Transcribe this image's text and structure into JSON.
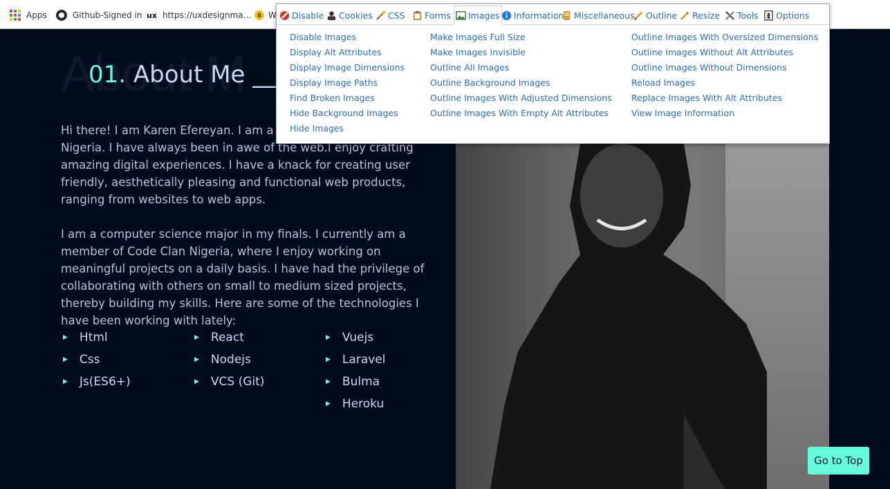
{
  "bookmarks": {
    "items": [
      {
        "label": "Apps"
      },
      {
        "label": "Github-Signed in"
      },
      {
        "label": "https://uxdesignma..."
      },
      {
        "label": "W"
      }
    ]
  },
  "about": {
    "ghost_text": "About M",
    "title_number": "01.",
    "title_text": "About Me __",
    "paragraphs": [
      "Hi there! I am Karen Efereyan. I am a fro",
      "Nigeria. I have always been in awe of the web.I enjoy crafting amazing digital experiences. I have a knack for creating user friendly, aesthetically pleasing and functional web products, ranging from websites to web apps.",
      "I am a computer science major in my finals. I currently am a member of Code Clan Nigeria, where I enjoy working on meaningful projects on a daily basis. I have had the privilege of collaborating with others on small to medium sized projects, thereby building my skills. Here are some of the technologies I have been working with lately:"
    ],
    "technologies": [
      "Html",
      "Css",
      "Js(ES6+)",
      "React",
      "Nodejs",
      "VCS (Git)",
      "Vuejs",
      "Laravel",
      "Bulma",
      "Heroku"
    ]
  },
  "go_top": {
    "label": "Go to Top"
  },
  "webdev_toolbar": {
    "tabs": [
      {
        "label": "Disable",
        "icon": "disable-icon"
      },
      {
        "label": "Cookies",
        "icon": "cookies-icon"
      },
      {
        "label": "CSS",
        "icon": "css-icon"
      },
      {
        "label": "Forms",
        "icon": "forms-icon"
      },
      {
        "label": "Images",
        "icon": "images-icon",
        "active": true
      },
      {
        "label": "Information",
        "icon": "information-icon"
      },
      {
        "label": "Miscellaneous",
        "icon": "miscellaneous-icon"
      },
      {
        "label": "Outline",
        "icon": "outline-icon"
      },
      {
        "label": "Resize",
        "icon": "resize-icon"
      },
      {
        "label": "Tools",
        "icon": "tools-icon"
      },
      {
        "label": "Options",
        "icon": "options-icon"
      }
    ],
    "menu_columns": [
      [
        "Disable Images",
        "Display Alt Attributes",
        "Display Image Dimensions",
        "Display Image Paths",
        "Find Broken Images",
        "Hide Background Images",
        "Hide Images"
      ],
      [
        "Make Images Full Size",
        "Make Images Invisible",
        "Outline All Images",
        "Outline Background Images",
        "Outline Images With Adjusted Dimensions",
        "Outline Images With Empty Alt Attributes"
      ],
      [
        "Outline Images With Oversized Dimensions",
        "Outline Images Without Alt Attributes",
        "Outline Images Without Dimensions",
        "Reload Images",
        "Replace Images With Alt Attributes",
        "View Image Information"
      ]
    ],
    "colors": {
      "link": "#2a6ebb",
      "accent": "#64ffda",
      "page_bg": "#020c1b"
    }
  }
}
